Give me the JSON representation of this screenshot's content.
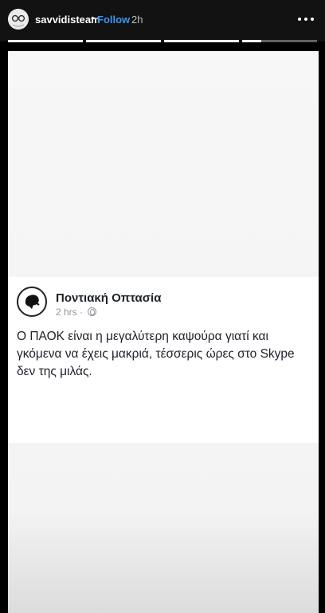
{
  "header": {
    "username": "savvidisteam",
    "separator": "•",
    "follow_label": "Follow",
    "time": "2h",
    "more_icon": "more-horizontal-icon"
  },
  "story_progress": {
    "segments_total": 4,
    "segments_viewed": 3,
    "current_segment_fill": 0.25
  },
  "post": {
    "page_name": "Ποντιακή Οπτασία",
    "time": "2 hrs ·",
    "privacy_icon": "globe-icon",
    "text": "Ο ΠΑΟΚ είναι η μεγαλύτερη καψούρα γιατί και γκόμενα να έχεις μακριά, τέσσερις ώρες στο Skype δεν της μιλάς."
  },
  "colors": {
    "follow": "#3897f0",
    "header_bg": "#121212",
    "story_bg": "#f5f5f5"
  }
}
